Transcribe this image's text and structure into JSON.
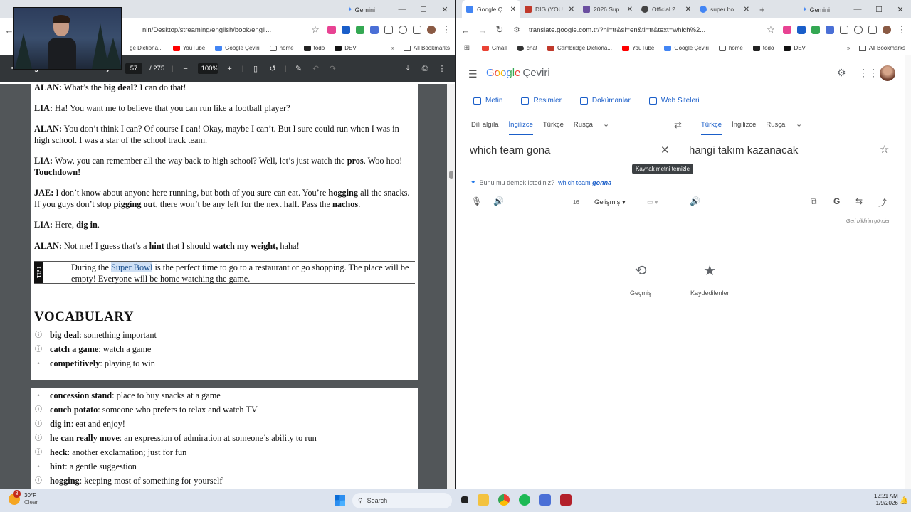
{
  "left_window": {
    "tabs_visible": "",
    "gemini_label": "Gemini",
    "url": "nin/Desktop/streaming/english/book/engli...",
    "bookmarks": [
      {
        "label": "ge Dictiona..."
      },
      {
        "label": "YouTube"
      },
      {
        "label": "Google Çeviri"
      },
      {
        "label": "home"
      },
      {
        "label": "todo"
      },
      {
        "label": "DEV"
      }
    ],
    "all_bookmarks": "All Bookmarks",
    "pdf": {
      "title": "English the American Way",
      "page_current": "57",
      "page_total": "/ 275",
      "zoom": "100%",
      "lines": {
        "l1_speaker": "ALAN:",
        "l1_a": " What’s the ",
        "l1_b": "big deal?",
        "l1_c": " I can do that!",
        "l2_speaker": "LIA:",
        "l2_a": " Ha! You want me to believe that you can run like a football player?",
        "l3_speaker": "ALAN:",
        "l3_a": " You don’t think I can? Of course I can! Okay, maybe I can’t. But I sure could run when I was in high school. I was a star of the school track team.",
        "l4_speaker": "LIA:",
        "l4_a": " Wow, you can remember all the way back to high school? Well, let’s just watch the ",
        "l4_b": "pros",
        "l4_c": ". Woo hoo! ",
        "l4_d": "Touchdown!",
        "l5_speaker": "JAE:",
        "l5_a": " I don’t know about anyone here running, but both of you sure can eat. You’re ",
        "l5_b": "hogging",
        "l5_c": " all the snacks. If you guys don’t stop ",
        "l5_d": "pigging out",
        "l5_e": ", there won’t be any left for the next half. Pass the ",
        "l5_f": "nachos",
        "l5_g": ".",
        "l6_speaker": "LIA:",
        "l6_a": " Here, ",
        "l6_b": "dig in",
        "l6_c": ".",
        "l7_speaker": "ALAN:",
        "l7_a": " Not me! I guess that’s a ",
        "l7_b": "hint",
        "l7_c": " that I should ",
        "l7_d": "watch my weight,",
        "l7_e": " haha!"
      },
      "tip_label": "TIP 1",
      "tip_a": "During the ",
      "tip_highlight": "Super Bowl",
      "tip_b": " is the perfect time to go to a restaurant or go shopping. The place will be empty! Everyone will be home watching the game.",
      "vocab_heading": "VOCABULARY",
      "vocab_page1": [
        {
          "term": "big deal",
          "def": ": something important"
        },
        {
          "term": "catch a game",
          "def": ": watch a game"
        },
        {
          "term": "competitively",
          "def": ": playing to win"
        }
      ],
      "vocab_page2": [
        {
          "term": "concession stand",
          "def": ": place to buy snacks at a game"
        },
        {
          "term": "couch potato",
          "def": ": someone who prefers to relax and watch TV"
        },
        {
          "term": "dig in",
          "def": ": eat and enjoy!"
        },
        {
          "term": "he can really move",
          "def": ": an expression of admiration at someone’s ability to run"
        },
        {
          "term": "heck",
          "def": ": another exclamation; just for fun"
        },
        {
          "term": "hint",
          "def": ": a gentle suggestion"
        },
        {
          "term": "hogging",
          "def": ": keeping most of something for yourself"
        }
      ]
    }
  },
  "right_window": {
    "tabs": [
      {
        "label": "Google Ç",
        "color": "#4285f4"
      },
      {
        "label": "DIG (YOU",
        "color": "#c0392b"
      },
      {
        "label": "2026 Sup",
        "color": "#6b4fa0"
      },
      {
        "label": "Official 2",
        "color": "#444444"
      },
      {
        "label": "super bo",
        "color": "#4285f4"
      }
    ],
    "gemini_label": "Gemini",
    "url": "translate.google.com.tr/?hl=tr&sl=en&tl=tr&text=which%2...",
    "bookmarks": [
      {
        "label": "Gmail"
      },
      {
        "label": "chat"
      },
      {
        "label": "Cambridge Dictiona..."
      },
      {
        "label": "YouTube"
      },
      {
        "label": "Google Çeviri"
      },
      {
        "label": "home"
      },
      {
        "label": "todo"
      },
      {
        "label": "DEV"
      }
    ],
    "all_bookmarks": "All Bookmarks",
    "translate": {
      "logo_google": "Google",
      "logo_ceviri": "Çeviri",
      "modes": [
        "Metin",
        "Resimler",
        "Dokümanlar",
        "Web Siteleri"
      ],
      "src_langs": [
        "Dili algıla",
        "İngilizce",
        "Türkçe",
        "Rusça"
      ],
      "tgt_langs": [
        "Türkçe",
        "İngilizce",
        "Rusça"
      ],
      "source_text": "which team gona",
      "target_text": "hangi takım kazanacak",
      "tooltip": "Kaynak metni temizle",
      "did_you_mean": "Bunu mu demek istediniz?",
      "suggest_plain": "which team ",
      "suggest_em": "gonna",
      "char_count": "16",
      "gelismis": "Gelişmiş",
      "feedback": "Geri bildirim gönder",
      "history": "Geçmiş",
      "saved": "Kaydedilenler"
    }
  },
  "taskbar": {
    "temp": "30°F",
    "weather": "Clear",
    "badge": "8",
    "search": "Search",
    "time": "12:21 AM",
    "date": "1/9/2026"
  }
}
